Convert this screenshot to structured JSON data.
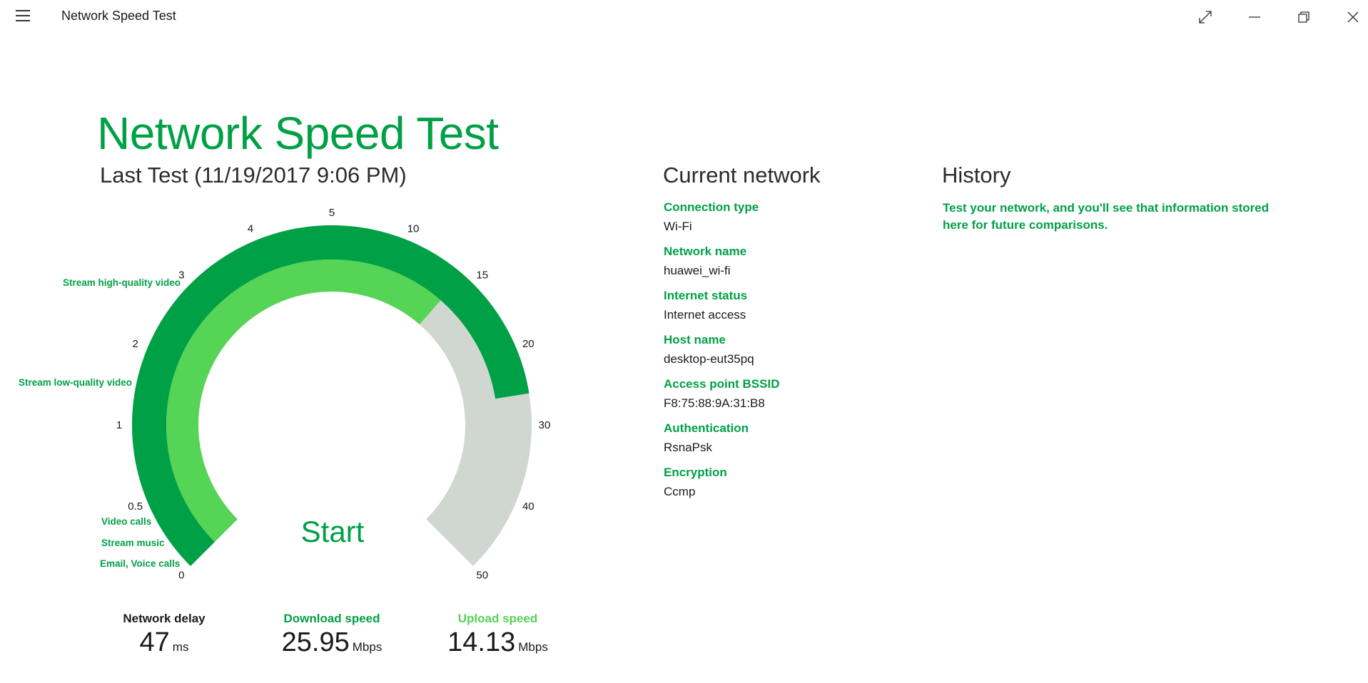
{
  "window": {
    "title": "Network Speed Test",
    "controls": [
      "full-screen",
      "minimize",
      "restore",
      "close"
    ]
  },
  "main": {
    "heading": "Network Speed Test",
    "last_test": "Last Test (11/19/2017 9:06 PM)",
    "start_label": "Start"
  },
  "gauge": {
    "ticks": [
      "0",
      "0.5",
      "1",
      "2",
      "3",
      "4",
      "5",
      "10",
      "15",
      "20",
      "30",
      "40",
      "50"
    ],
    "zones": {
      "email": "Email, Voice calls",
      "music": "Stream music",
      "video_calls": "Video calls",
      "low_video": "Stream low-quality video",
      "high_video": "Stream high-quality video"
    },
    "download_mbps": 25.95,
    "upload_mbps": 14.13,
    "colors": {
      "download": "#00a046",
      "upload": "#55d455",
      "track": "#d0d6d0"
    }
  },
  "metrics": {
    "delay": {
      "label": "Network delay",
      "value": "47",
      "unit": "ms"
    },
    "download": {
      "label": "Download speed",
      "value": "25.95",
      "unit": "Mbps"
    },
    "upload": {
      "label": "Upload speed",
      "value": "14.13",
      "unit": "Mbps"
    }
  },
  "network": {
    "heading": "Current network",
    "fields": [
      {
        "label": "Connection type",
        "value": "Wi-Fi"
      },
      {
        "label": "Network name",
        "value": "huawei_wi-fi"
      },
      {
        "label": "Internet status",
        "value": "Internet access"
      },
      {
        "label": "Host name",
        "value": "desktop-eut35pq"
      },
      {
        "label": "Access point BSSID",
        "value": "F8:75:88:9A:31:B8"
      },
      {
        "label": "Authentication",
        "value": "RsnaPsk"
      },
      {
        "label": "Encryption",
        "value": "Ccmp"
      }
    ]
  },
  "history": {
    "heading": "History",
    "message": "Test your network, and you'll see that information stored here for future comparisons."
  }
}
